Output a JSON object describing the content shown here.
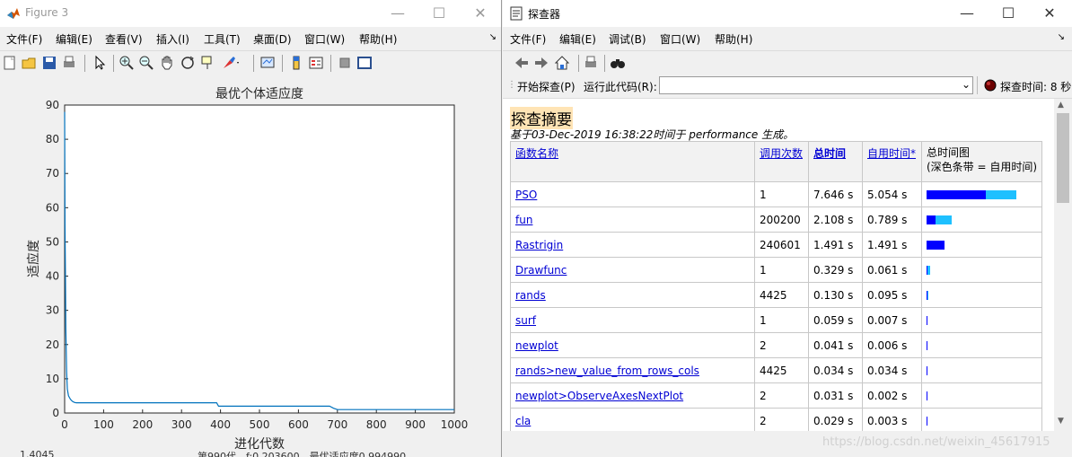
{
  "figure": {
    "window_title": "Figure 3",
    "menu": [
      "文件(F)",
      "编辑(E)",
      "查看(V)",
      "插入(I)",
      "工具(T)",
      "桌面(D)",
      "窗口(W)",
      "帮助(H)"
    ],
    "bottom_text_left": "1.4045",
    "bottom_text_right": "第990代，f:0.203600，最优适应度0.994990"
  },
  "profiler": {
    "window_title": "探查器",
    "menu": [
      "文件(F)",
      "编辑(E)",
      "调试(B)",
      "窗口(W)",
      "帮助(H)"
    ],
    "start_label": "开始探查(P)",
    "run_code_label": "运行此代码(R):",
    "run_code_value": "",
    "time_label": "探查时间: 8 秒",
    "report_title": "探查摘要",
    "report_subtitle": "基于03-Dec-2019 16:38:22时间于 performance 生成。",
    "columns": {
      "name": "函数名称",
      "calls": "调用次数",
      "total": "总时间",
      "self": "自用时间*",
      "chart_line1": "总时间图",
      "chart_line2": "(深色条带 = 自用时间)"
    },
    "rows": [
      {
        "name": "PSO",
        "calls": "1",
        "total": "7.646 s",
        "self": "5.054 s",
        "total_v": 7.646,
        "self_v": 5.054
      },
      {
        "name": "fun",
        "calls": "200200",
        "total": "2.108 s",
        "self": "0.789 s",
        "total_v": 2.108,
        "self_v": 0.789
      },
      {
        "name": "Rastrigin",
        "calls": "240601",
        "total": "1.491 s",
        "self": "1.491 s",
        "total_v": 1.491,
        "self_v": 1.491
      },
      {
        "name": "Drawfunc",
        "calls": "1",
        "total": "0.329 s",
        "self": "0.061 s",
        "total_v": 0.329,
        "self_v": 0.061
      },
      {
        "name": "rands",
        "calls": "4425",
        "total": "0.130 s",
        "self": "0.095 s",
        "total_v": 0.13,
        "self_v": 0.095
      },
      {
        "name": "surf",
        "calls": "1",
        "total": "0.059 s",
        "self": "0.007 s",
        "total_v": 0.059,
        "self_v": 0.007
      },
      {
        "name": "newplot",
        "calls": "2",
        "total": "0.041 s",
        "self": "0.006 s",
        "total_v": 0.041,
        "self_v": 0.006
      },
      {
        "name": "rands>new_value_from_rows_cols",
        "calls": "4425",
        "total": "0.034 s",
        "self": "0.034 s",
        "total_v": 0.034,
        "self_v": 0.034
      },
      {
        "name": "newplot>ObserveAxesNextPlot",
        "calls": "2",
        "total": "0.031 s",
        "self": "0.002 s",
        "total_v": 0.031,
        "self_v": 0.002
      },
      {
        "name": "cla",
        "calls": "2",
        "total": "0.029 s",
        "self": "0.003 s",
        "total_v": 0.029,
        "self_v": 0.003
      }
    ],
    "watermark": "https://blog.csdn.net/weixin_45617915"
  },
  "chart_data": {
    "type": "line",
    "title": "最优个体适应度",
    "xlabel": "进化代数",
    "ylabel": "适应度",
    "xlim": [
      0,
      1000
    ],
    "ylim": [
      0,
      90
    ],
    "xticks": [
      0,
      100,
      200,
      300,
      400,
      500,
      600,
      700,
      800,
      900,
      1000
    ],
    "yticks": [
      0,
      10,
      20,
      30,
      40,
      50,
      60,
      70,
      80,
      90
    ],
    "color": "#0072bd",
    "series": [
      {
        "x": [
          0,
          1,
          2,
          3,
          5,
          7,
          10,
          15,
          20,
          25,
          30,
          390,
          395,
          680,
          690,
          700,
          1000
        ],
        "y": [
          88,
          55,
          40,
          25,
          12,
          7,
          5,
          4,
          3.4,
          3.1,
          3.0,
          3.0,
          2.0,
          2.0,
          1.4,
          1.0,
          1.0
        ]
      }
    ]
  }
}
